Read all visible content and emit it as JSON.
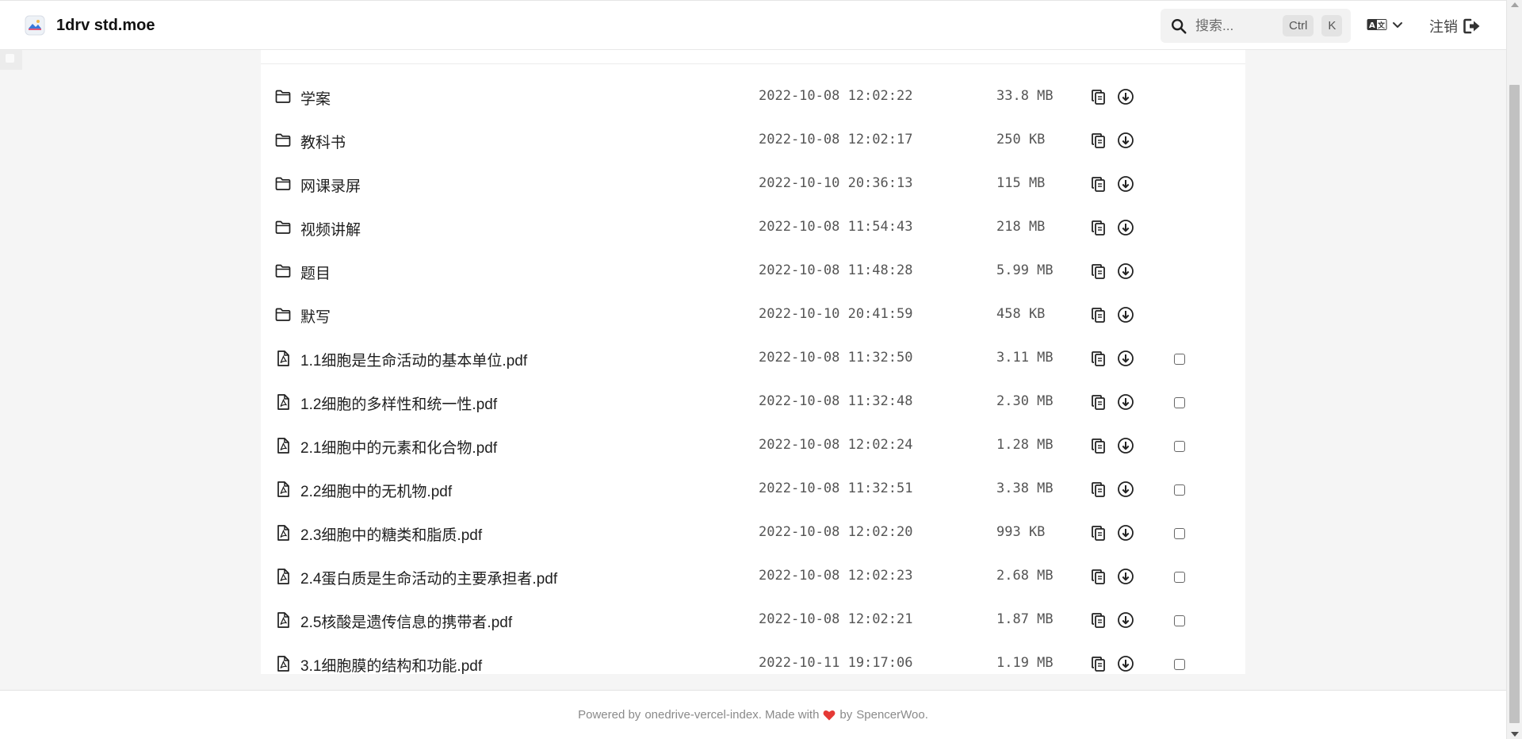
{
  "header": {
    "brand": "1drv std.moe",
    "search_placeholder": "搜索...",
    "kbd_ctrl": "Ctrl",
    "kbd_k": "K",
    "logout_label": "注销"
  },
  "files": [
    {
      "type": "folder",
      "name": "学案",
      "modified": "2022-10-08 12:02:22",
      "size": "33.8 MB"
    },
    {
      "type": "folder",
      "name": "教科书",
      "modified": "2022-10-08 12:02:17",
      "size": "250 KB"
    },
    {
      "type": "folder",
      "name": "网课录屏",
      "modified": "2022-10-10 20:36:13",
      "size": "115 MB"
    },
    {
      "type": "folder",
      "name": "视频讲解",
      "modified": "2022-10-08 11:54:43",
      "size": "218 MB"
    },
    {
      "type": "folder",
      "name": "题目",
      "modified": "2022-10-08 11:48:28",
      "size": "5.99 MB"
    },
    {
      "type": "folder",
      "name": "默写",
      "modified": "2022-10-10 20:41:59",
      "size": "458 KB"
    },
    {
      "type": "pdf",
      "name": "1.1细胞是生命活动的基本单位.pdf",
      "modified": "2022-10-08 11:32:50",
      "size": "3.11 MB"
    },
    {
      "type": "pdf",
      "name": "1.2细胞的多样性和统一性.pdf",
      "modified": "2022-10-08 11:32:48",
      "size": "2.30 MB"
    },
    {
      "type": "pdf",
      "name": "2.1细胞中的元素和化合物.pdf",
      "modified": "2022-10-08 12:02:24",
      "size": "1.28 MB"
    },
    {
      "type": "pdf",
      "name": "2.2细胞中的无机物.pdf",
      "modified": "2022-10-08 11:32:51",
      "size": "3.38 MB"
    },
    {
      "type": "pdf",
      "name": "2.3细胞中的糖类和脂质.pdf",
      "modified": "2022-10-08 12:02:20",
      "size": "993 KB"
    },
    {
      "type": "pdf",
      "name": "2.4蛋白质是生命活动的主要承担者.pdf",
      "modified": "2022-10-08 12:02:23",
      "size": "2.68 MB"
    },
    {
      "type": "pdf",
      "name": "2.5核酸是遗传信息的携带者.pdf",
      "modified": "2022-10-08 12:02:21",
      "size": "1.87 MB"
    },
    {
      "type": "pdf",
      "name": "3.1细胞膜的结构和功能.pdf",
      "modified": "2022-10-11 19:17:06",
      "size": "1.19 MB"
    }
  ],
  "footer": {
    "prefix": "Powered by",
    "project": "onedrive-vercel-index",
    "made_with": ". Made with",
    "by": "by",
    "author": "SpencerWoo",
    "suffix": "."
  },
  "colors": {
    "heart": "#e53935",
    "page_bg": "#f5f5f5",
    "card_bg": "#ffffff"
  }
}
